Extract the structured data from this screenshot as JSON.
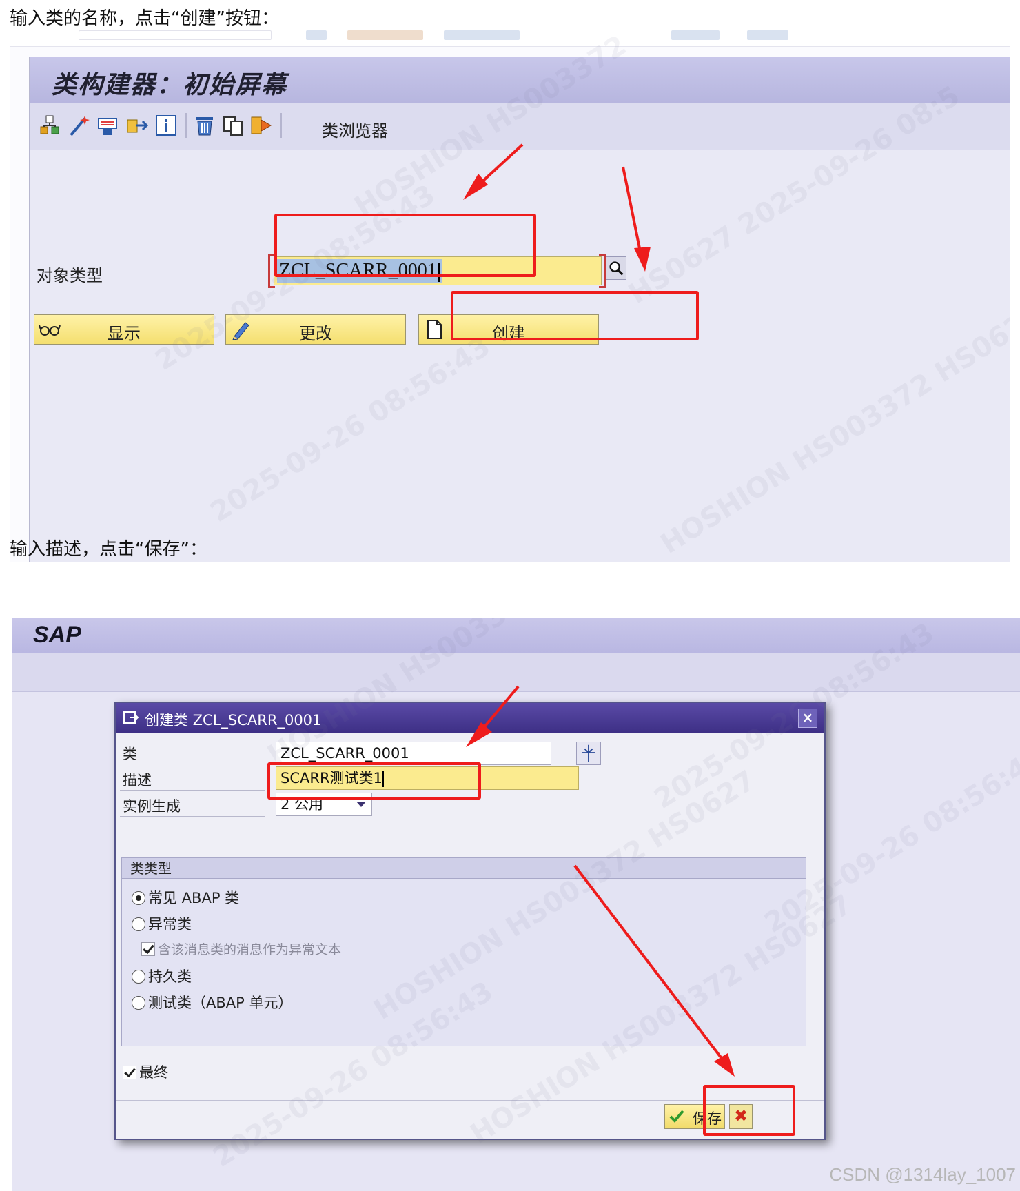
{
  "captions": {
    "step1": "输入类的名称，点击“创建”按钮：",
    "step2": "输入描述，点击“保存”："
  },
  "screen1": {
    "title": "类构建器：初始屏幕",
    "toolbar": {
      "icons": [
        "hierarchy-icon",
        "magic-wand-icon",
        "print-icon",
        "export-icon",
        "info-icon",
        "delete-icon",
        "copy-icon",
        "translate-icon"
      ],
      "class_browser_label": "类浏览器"
    },
    "object_type_label": "对象类型",
    "object_type_value": "ZCL_SCARR_0001",
    "buttons": {
      "display": "显示",
      "change": "更改",
      "create": "创建"
    }
  },
  "screen2": {
    "logo": "SAP",
    "dialog": {
      "title": "创建类 ZCL_SCARR_0001",
      "class_label": "类",
      "class_value": "ZCL_SCARR_0001",
      "description_label": "描述",
      "description_value": "SCARR测试类1",
      "instantiation_label": "实例生成",
      "instantiation_value": "2 公用",
      "class_type_group": "类类型",
      "options": {
        "regular": "常见 ABAP 类",
        "exception": "异常类",
        "message_text": "含该消息类的消息作为异常文本",
        "persistent": "持久类",
        "test": "测试类（ABAP 单元）"
      },
      "final_label": "最终",
      "save_label": "保存"
    }
  },
  "footer": "CSDN @1314lay_1007",
  "colors": {
    "annotation_red": "#ee1c1c",
    "required_field": "#fbeb8f",
    "dialog_title": "#3d2f85"
  }
}
